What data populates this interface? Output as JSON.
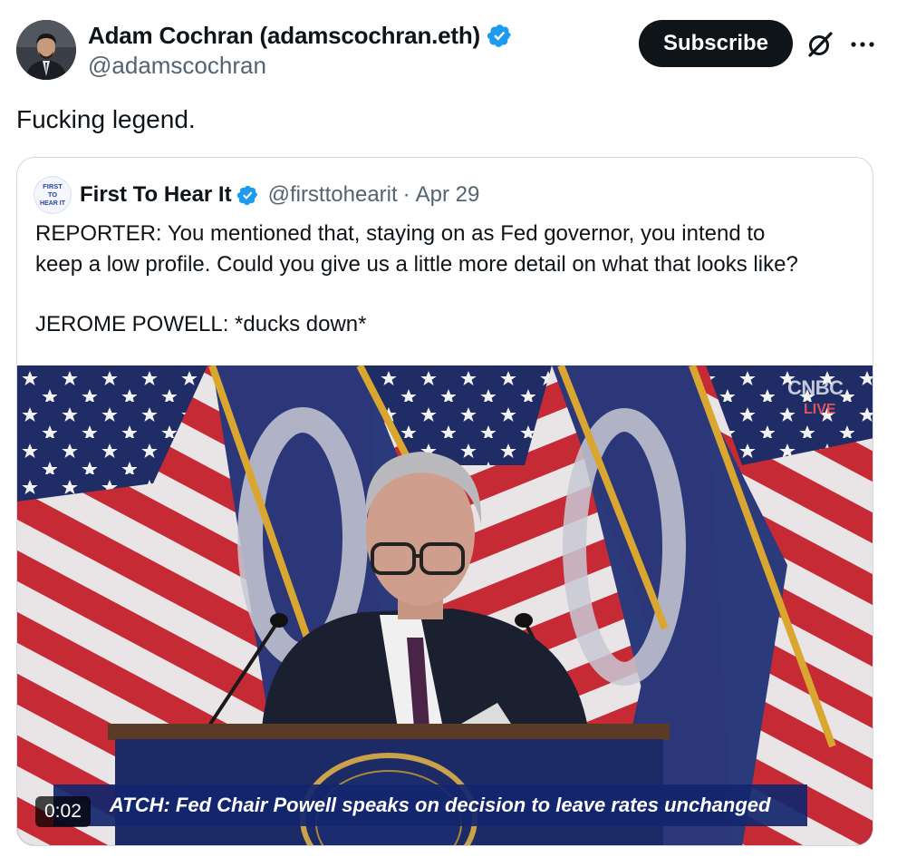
{
  "author": {
    "name": "Adam Cochran (adamscochran.eth)",
    "handle": "@adamscochran",
    "subscribe_label": "Subscribe"
  },
  "tweet": {
    "text": "Fucking legend."
  },
  "quoted": {
    "name": "First To Hear It",
    "handle": "@firsttohearit",
    "separator": "·",
    "date": "Apr 29",
    "avatar_text": [
      "FIRST",
      "TO",
      "HEAR IT"
    ],
    "body_lines": [
      "REPORTER: You mentioned that, staying on as Fed governor, you intend to",
      "keep a low profile. Could you give us a little more detail on what that looks like?",
      "JEROME POWELL: *ducks down*"
    ]
  },
  "video": {
    "caption": "ATCH: Fed Chair Powell speaks on decision to leave rates unchanged",
    "timer": "0:02",
    "network_logo": "CNBC",
    "live_label": "LIVE"
  },
  "icons": {
    "verified": "verified-badge-icon",
    "grok": "grok-icon",
    "more": "more-icon"
  },
  "colors": {
    "verified_blue": "#1d9bf0",
    "text_primary": "#0f1419",
    "text_secondary": "#536471",
    "border": "#cfd9de",
    "button_dark": "#0f1419"
  }
}
